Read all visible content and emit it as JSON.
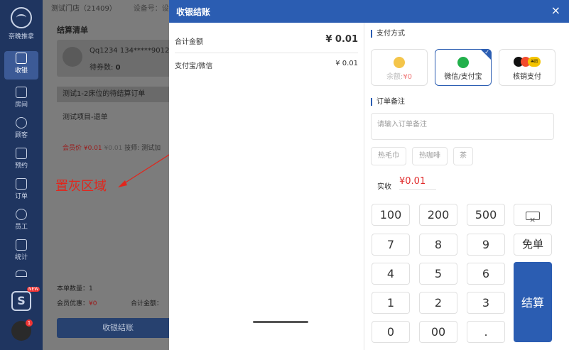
{
  "nav": {
    "brand": "奈晚推拿",
    "items": [
      {
        "label": "收银",
        "active": true
      },
      {
        "label": "房间"
      },
      {
        "label": "顾客"
      },
      {
        "label": "预约"
      },
      {
        "label": "订单"
      },
      {
        "label": "员工"
      },
      {
        "label": "统计"
      }
    ],
    "new_tag": "NEW",
    "notify_count": "1"
  },
  "background_page": {
    "store": "测试门店（21409）",
    "device": "设备号：设备",
    "section_title": "结算清单",
    "customer_line": "Qq1234 134*****9012",
    "coupon_label": "待券数:",
    "coupon_value": "0",
    "order_bar": "测试1-2床位的待结算订单",
    "item_name": "测试项目-退单",
    "price_label": "会员价",
    "price_member": "¥0.01",
    "price_original": "¥0.01",
    "tech_label": "技师: 测试加",
    "qty": "本单数量：1",
    "discount_label": "会员优惠：",
    "discount_value": "¥0",
    "total_label": "合计金额：",
    "checkout_label": "收银结账"
  },
  "annotation": {
    "label": "置灰区域"
  },
  "modal": {
    "title": "收银结账",
    "close_glyph": "×",
    "summary": [
      {
        "label": "合计金额",
        "value": "¥ 0.01"
      },
      {
        "label": "支付宝/微信",
        "value": "¥ 0.01"
      }
    ],
    "payment_section": "支付方式",
    "payment_methods": [
      {
        "label": "余额:",
        "amount": "¥0",
        "state": "disabled"
      },
      {
        "label": "微信/支付宝",
        "state": "selected"
      },
      {
        "label": "核销支付",
        "state": "normal"
      }
    ],
    "writeoff_icon_text": "美团",
    "remark_section": "订单备注",
    "remark_placeholder": "请输入订单备注",
    "remark_value": "",
    "tags": [
      "热毛巾",
      "热咖啡",
      "茶"
    ],
    "actual_label": "实收",
    "actual_value": "¥0.01",
    "keypad": {
      "quick": [
        "100",
        "200",
        "500"
      ],
      "digits": [
        "7",
        "8",
        "9",
        "4",
        "5",
        "6",
        "1",
        "2",
        "3",
        "0",
        "00",
        "."
      ],
      "free_label": "免单",
      "settle_label": "结算"
    }
  },
  "colors": {
    "primary": "#2b5db2",
    "nav_bg": "#1f3560",
    "price_red": "#e02a2a",
    "annotation_red": "#e1261c",
    "wechat_green": "#22b04b"
  }
}
